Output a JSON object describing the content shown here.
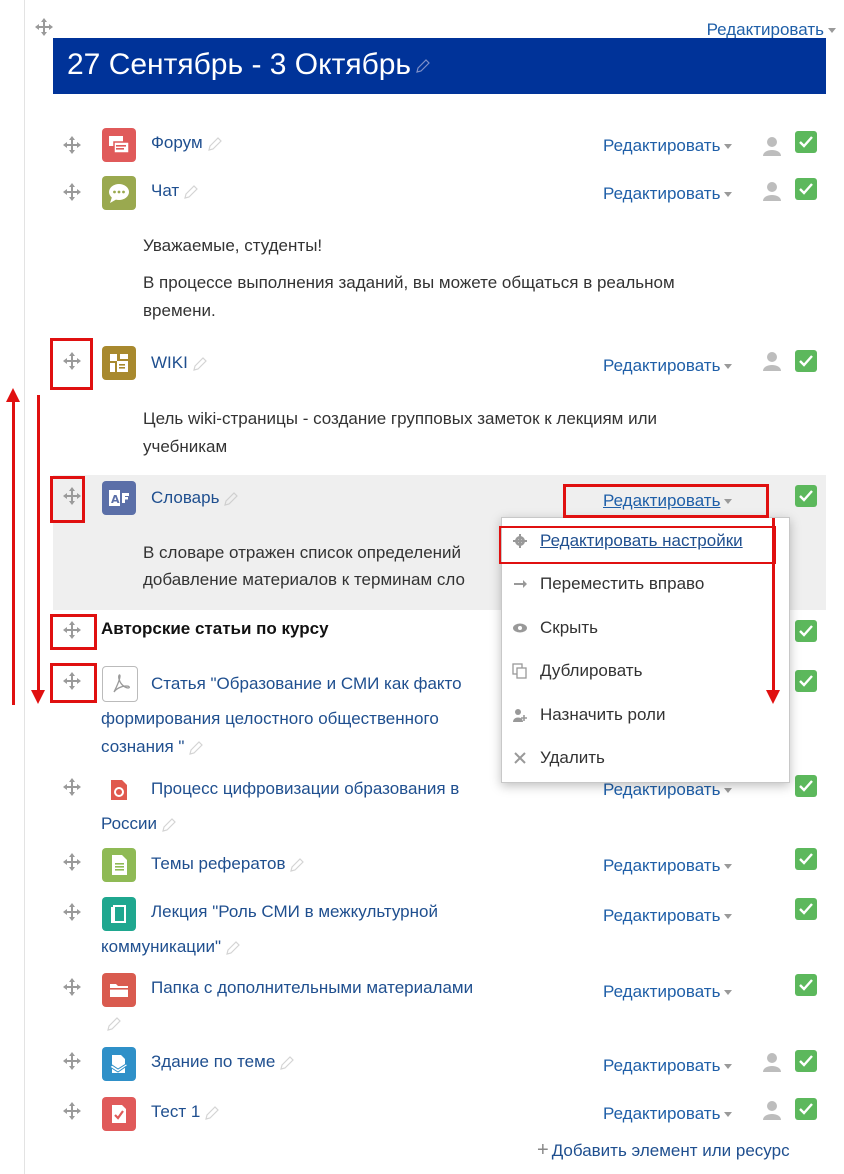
{
  "section": {
    "title": "27 Сентябрь - 3 Октябрь",
    "edit_label": "Редактировать"
  },
  "items": [
    {
      "name": "Форум",
      "edit": "Редактировать"
    },
    {
      "name": "Чат",
      "edit": "Редактировать"
    },
    {
      "name": "WIKI",
      "edit": "Редактировать"
    },
    {
      "name": "Словарь",
      "edit": "Редактировать"
    },
    {
      "name": "Авторские статьи по курсу"
    },
    {
      "name_l1": "Статья \"Образование и СМИ как факто",
      "name_l2": "формирования целостного общественного",
      "name_l3": "сознания \""
    },
    {
      "name_l1": "Процесс цифровизации образования в",
      "name_l2": "России",
      "edit": "Редактировать"
    },
    {
      "name": "Темы рефератов",
      "edit": "Редактировать"
    },
    {
      "name_l1": "Лекция \"Роль СМИ в межкультурной",
      "name_l2": "коммуникации\"",
      "edit": "Редактировать"
    },
    {
      "name": "Папка с дополнительными материалами",
      "edit": "Редактировать"
    },
    {
      "name": "Здание по теме",
      "edit": "Редактировать"
    },
    {
      "name": "Тест 1",
      "edit": "Редактировать"
    }
  ],
  "descriptions": {
    "chat_l1": "Уважаемые, студенты!",
    "chat_l2": "В процессе выполнения заданий, вы можете общаться в реальном",
    "chat_l3": "времени.",
    "wiki_l1": "Цель wiki-страницы - создание групповых заметок к лекциям или",
    "wiki_l2": "учебникам",
    "gloss_l1": "В словаре отражен список определений",
    "gloss_l2": "добавление материалов к терминам сло"
  },
  "menu": {
    "items": [
      {
        "label": "Редактировать настройки",
        "icon": "gear-icon"
      },
      {
        "label": "Переместить вправо",
        "icon": "arrow-right-icon"
      },
      {
        "label": "Скрыть",
        "icon": "eye-icon"
      },
      {
        "label": "Дублировать",
        "icon": "copy-icon"
      },
      {
        "label": "Назначить роли",
        "icon": "assign-roles-icon"
      },
      {
        "label": "Удалить",
        "icon": "close-icon"
      }
    ]
  },
  "add_resource": "Добавить элемент или ресурс",
  "colors": {
    "banner": "#003399",
    "link": "#1f4f8f",
    "check": "#5cb85c",
    "annotation": "#e01010"
  }
}
